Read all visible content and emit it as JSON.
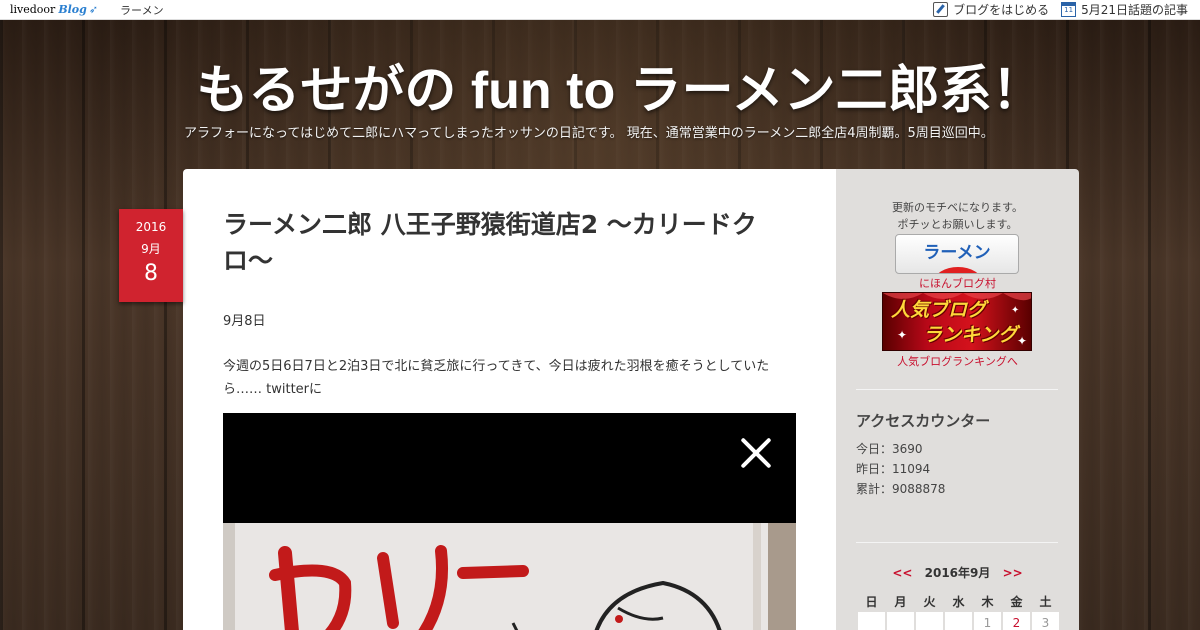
{
  "topbar": {
    "logo_text": "livedoor",
    "logo_blog": "Blog",
    "category": "ラーメン",
    "start_blog": "ブログをはじめる",
    "calendar_day": "11",
    "trending": "5月21日話題の記事"
  },
  "header": {
    "title": "もるせがの fun to ラーメン二郎系！",
    "description": "アラフォーになってはじめて二郎にハマってしまったオッサンの日記です。 現在、通常営業中のラーメン二郎全店4周制覇。5周目巡回中。"
  },
  "post": {
    "date": {
      "year": "2016",
      "month": "9月",
      "day": "8"
    },
    "title": "ラーメン二郎 八王子野猿街道店2 〜カリードクロ〜",
    "p1": "9月8日",
    "p2": "今週の5日6日7日と2泊3日で北に貧乏旅に行ってきて、今日は疲れた羽根を癒そうとしていたら…… twitterに"
  },
  "sidebar": {
    "note_line1": "更新のモチベになります。",
    "note_line2": "ポチッとお願いします。",
    "ramen_button": "ラーメン",
    "nihon_link": "にほんブログ村",
    "banner_line1": "人気ブログ",
    "banner_line2": "ランキング",
    "ranking_link": "人気ブログランキングへ",
    "counter_title": "アクセスカウンター",
    "today": "今日：3690",
    "yesterday": "昨日：11094",
    "total": "累計：9088878",
    "calendar": {
      "prev": "<<",
      "month": "2016年9月",
      "next": ">>",
      "weekdays": [
        "日",
        "月",
        "火",
        "水",
        "木",
        "金",
        "土"
      ],
      "first_row": [
        "",
        "",
        "",
        "",
        "1",
        "2",
        "3"
      ]
    }
  }
}
